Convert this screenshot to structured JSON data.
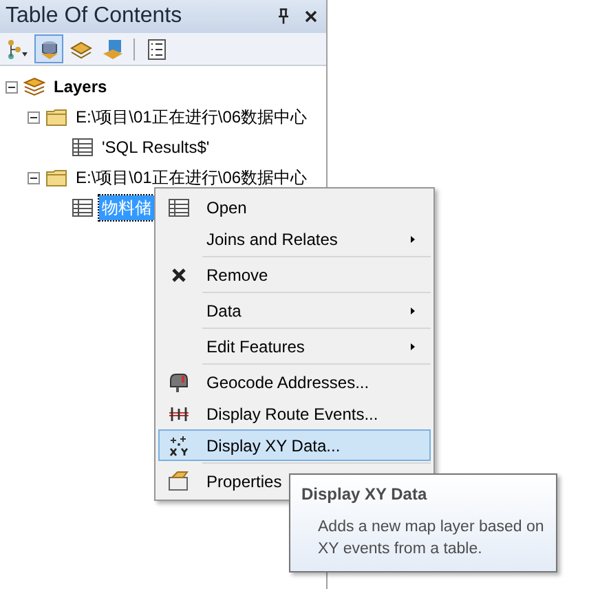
{
  "panel": {
    "title": "Table Of Contents"
  },
  "toolbar": [
    {
      "kind": "drawing-order",
      "selected": false
    },
    {
      "kind": "source",
      "selected": true
    },
    {
      "kind": "visibility",
      "selected": false
    },
    {
      "kind": "selection",
      "selected": false
    },
    {
      "kind": "options",
      "selected": false
    }
  ],
  "tree": {
    "label": "Layers",
    "expanded": true,
    "children": [
      {
        "label": "E:\\项目\\01正在进行\\06数据中心",
        "expanded": true,
        "children": [
          {
            "label": "'SQL Results$'",
            "selected": false
          }
        ]
      },
      {
        "label": "E:\\项目\\01正在进行\\06数据中心",
        "expanded": true,
        "children": [
          {
            "label": "物料储",
            "selected": true
          }
        ]
      }
    ]
  },
  "context_menu": [
    {
      "label": "Open",
      "kind": "table",
      "submenu": false,
      "selected": false,
      "separator_after": false
    },
    {
      "label": "Joins and Relates",
      "kind": "plain",
      "submenu": true,
      "selected": false,
      "separator_after": true
    },
    {
      "label": "Remove",
      "kind": "remove",
      "submenu": false,
      "selected": false,
      "separator_after": true
    },
    {
      "label": "Data",
      "kind": "plain",
      "submenu": true,
      "selected": false,
      "separator_after": true
    },
    {
      "label": "Edit Features",
      "kind": "plain",
      "submenu": true,
      "selected": false,
      "separator_after": true
    },
    {
      "label": "Geocode Addresses...",
      "kind": "geocode",
      "submenu": false,
      "selected": false,
      "separator_after": false
    },
    {
      "label": "Display Route Events...",
      "kind": "route",
      "submenu": false,
      "selected": false,
      "separator_after": false
    },
    {
      "label": "Display XY Data...",
      "kind": "xy",
      "submenu": false,
      "selected": true,
      "separator_after": true
    },
    {
      "label": "Properties",
      "kind": "properties",
      "submenu": false,
      "selected": false,
      "separator_after": false
    }
  ],
  "tooltip": {
    "title": "Display XY Data",
    "text": "Adds a new map layer based on XY events from a table."
  }
}
